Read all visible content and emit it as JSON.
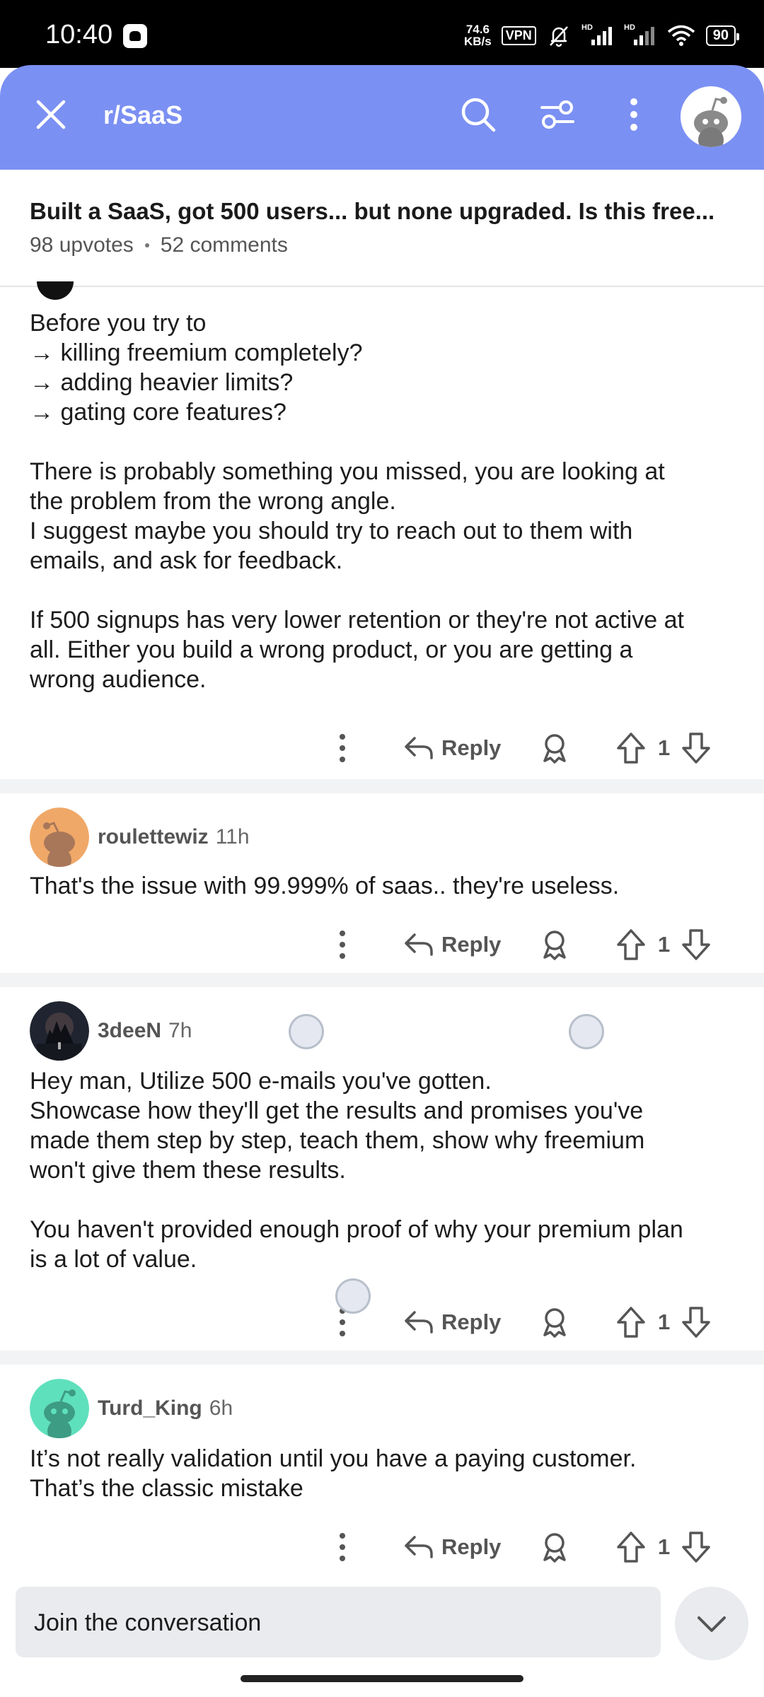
{
  "status_bar": {
    "time": "10:40",
    "speed_value": "74.6",
    "speed_unit": "KB/s",
    "vpn": "VPN",
    "battery": "90"
  },
  "appbar": {
    "title": "r/SaaS",
    "color": "#7b90f3",
    "icons": [
      "close-icon",
      "search-icon",
      "filter-icon",
      "more-vertical-icon",
      "avatar"
    ]
  },
  "post": {
    "title": "Built a SaaS, got 500 users... but none upgraded. Is this free...",
    "upvotes": "98 upvotes",
    "comments": "52 comments"
  },
  "comments": [
    {
      "author": "",
      "time": "",
      "body": [
        "Before you try to",
        "→ killing freemium completely?",
        "→ adding heavier limits?",
        "→ gating core features?",
        "",
        "There is probably something you missed, you are looking at",
        "the problem from the wrong angle.",
        "I suggest maybe you should try to reach out to them with",
        "emails, and ask for feedback.",
        "",
        "If 500 signups has very lower retention or they're not active at",
        "all. Either you build a wrong product, or you are getting a",
        "wrong audience."
      ],
      "reply_label": "Reply",
      "score": "1"
    },
    {
      "author": "roulettewiz",
      "time": "11h",
      "avatar_color": "#f0a868",
      "body": [
        "That's the issue with 99.999% of saas.. they're useless."
      ],
      "reply_label": "Reply",
      "score": "1"
    },
    {
      "author": "3deeN",
      "time": "7h",
      "avatar_color": "#2a2f3a",
      "body": [
        "Hey man, Utilize 500 e-mails you've gotten.",
        "Showcase how they'll get the results and promises you've",
        "made them step by step, teach them, show why freemium",
        "won't give them these results.",
        "",
        "You haven't provided enough proof of why your premium plan",
        "is a lot of value."
      ],
      "reply_label": "Reply",
      "score": "1"
    },
    {
      "author": "Turd_King",
      "time": "6h",
      "avatar_color": "#5fe0bd",
      "body": [
        "It’s not really validation until you have a paying customer.",
        "That’s the classic mistake"
      ],
      "reply_label": "Reply",
      "score": "1"
    }
  ],
  "compose": {
    "placeholder": "Join the conversation"
  }
}
